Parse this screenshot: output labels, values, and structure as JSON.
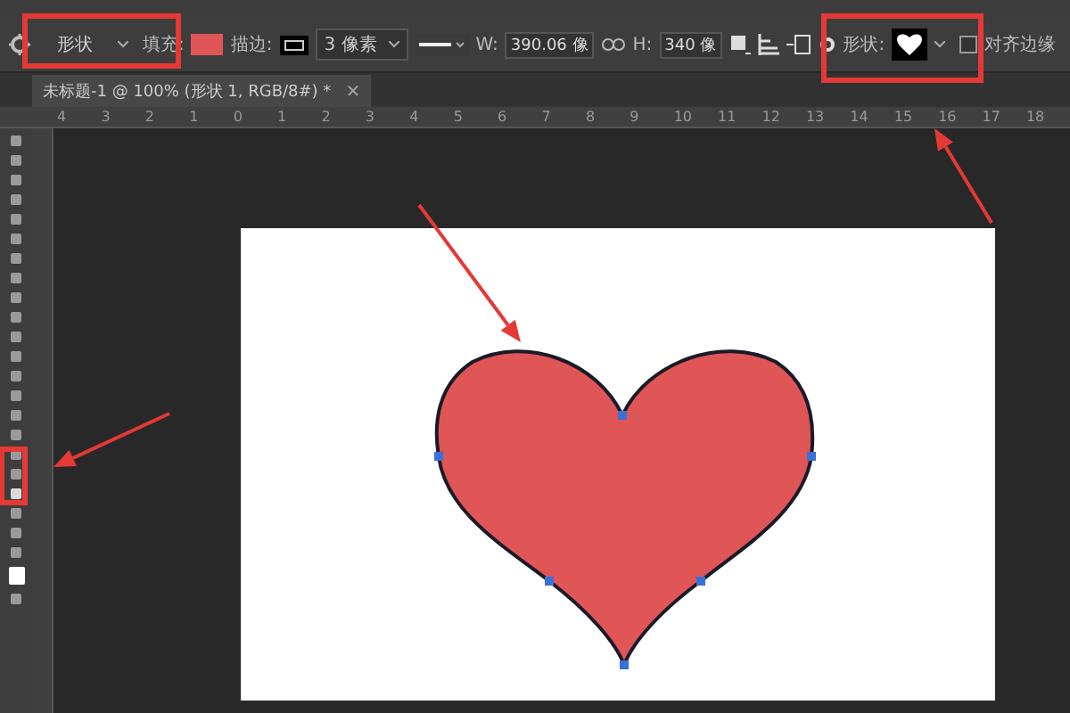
{
  "options_bar": {
    "mode": "形状",
    "fill_label": "填充:",
    "stroke_label": "描边:",
    "stroke_width": "3 像素",
    "width_label": "W:",
    "width": "390.06 像",
    "height_label": "H:",
    "height": "340 像",
    "shape_label": "形状:",
    "align_edges": {
      "label": "对齐边缘",
      "checked": false
    }
  },
  "document_tab": {
    "title": "未标题-1 @ 100% (形状 1, RGB/8#) *",
    "close": "×"
  },
  "ruler": {
    "marks": [
      "4",
      "3",
      "2",
      "1",
      "0",
      "1",
      "2",
      "3",
      "4",
      "5",
      "6",
      "7",
      "8",
      "9",
      "10",
      "11",
      "12",
      "13",
      "14",
      "15",
      "16",
      "17",
      "18"
    ]
  }
}
